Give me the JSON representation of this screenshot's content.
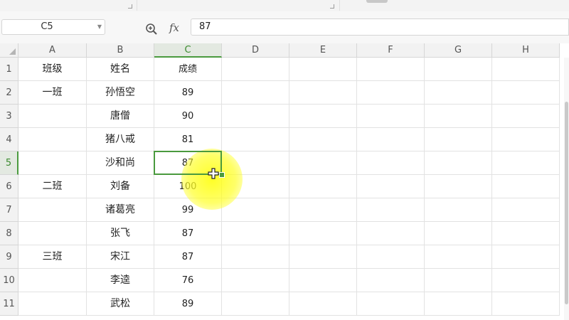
{
  "formula_bar": {
    "name_box": "C5",
    "fx_label": "fx",
    "formula_value": "87"
  },
  "sheet": {
    "columns": [
      "A",
      "B",
      "C",
      "D",
      "E",
      "F",
      "G",
      "H"
    ],
    "rows": [
      "1",
      "2",
      "3",
      "4",
      "5",
      "6",
      "7",
      "8",
      "9",
      "10",
      "11"
    ],
    "cells": [
      [
        "班级",
        "姓名",
        "成绩"
      ],
      [
        "一班",
        "孙悟空",
        "89"
      ],
      [
        "",
        "唐僧",
        "90"
      ],
      [
        "",
        "猪八戒",
        "81"
      ],
      [
        "",
        "沙和尚",
        "87"
      ],
      [
        "二班",
        "刘备",
        "100"
      ],
      [
        "",
        "诸葛亮",
        "99"
      ],
      [
        "",
        "张飞",
        "87"
      ],
      [
        "三班",
        "宋江",
        "87"
      ],
      [
        "",
        "李逵",
        "76"
      ],
      [
        "",
        "武松",
        "89"
      ]
    ],
    "active_cell": {
      "col": "C",
      "row": "5"
    }
  },
  "colors": {
    "selection": "#4a9a3e",
    "highlight": "#ffff00"
  },
  "icons": {
    "zoom": "magnifier-zoom-icon",
    "cursor": "cross-cursor-icon",
    "select_all": "select-all-triangle-icon"
  }
}
